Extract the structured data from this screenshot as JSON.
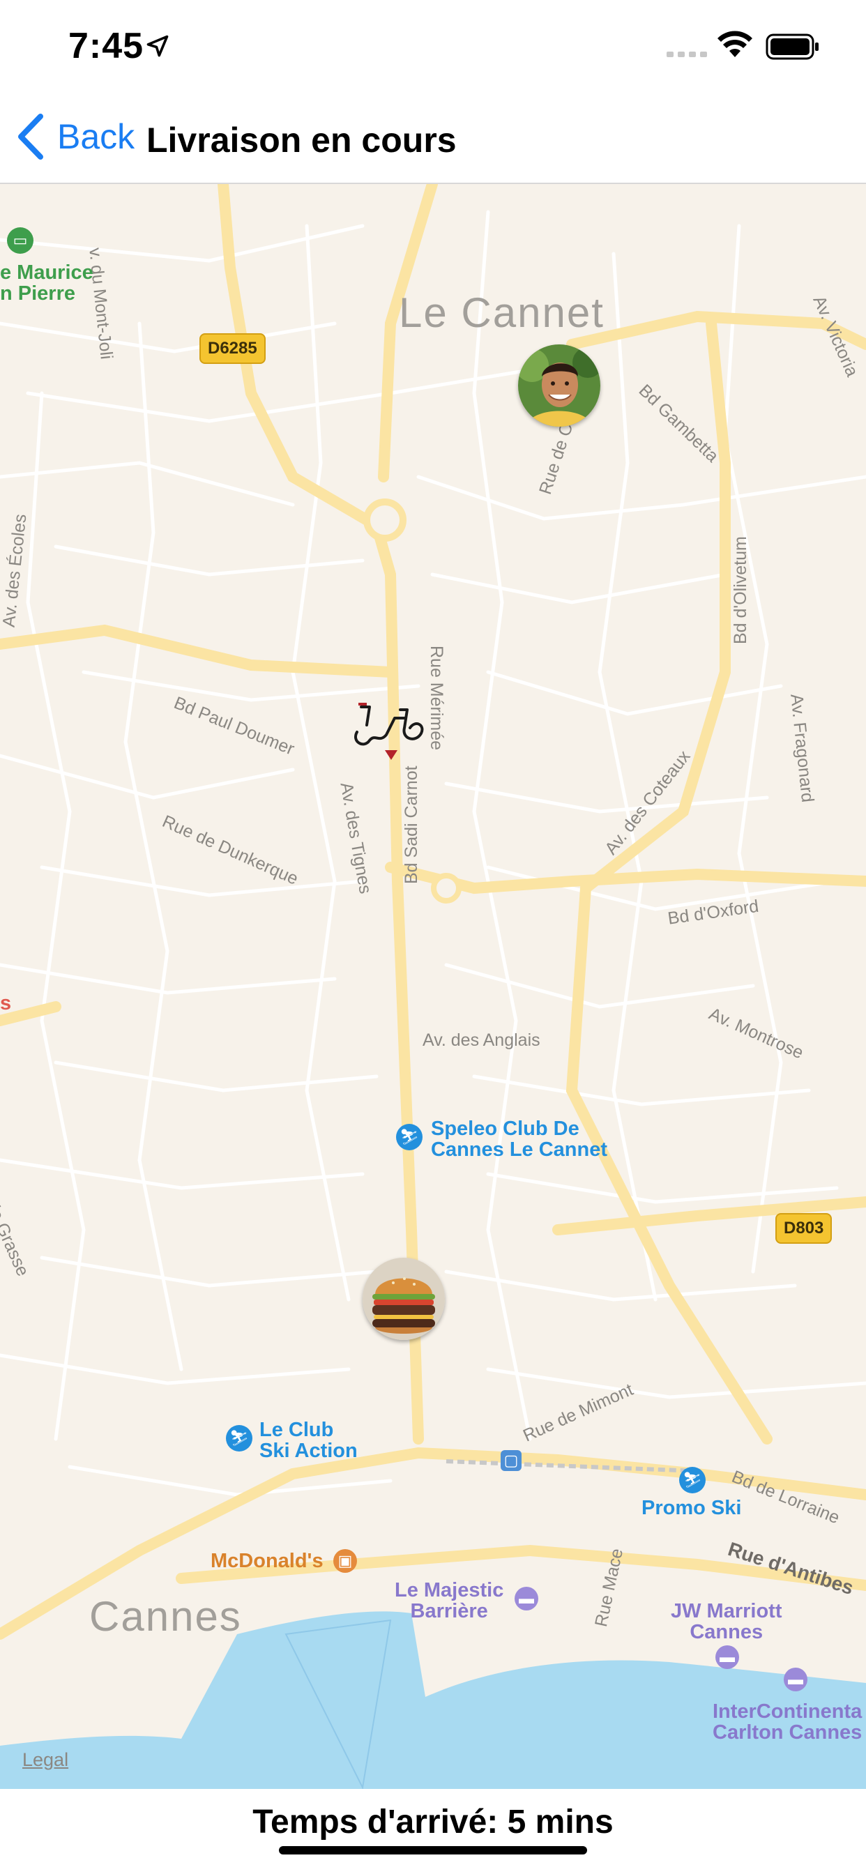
{
  "status_bar": {
    "time": "7:45",
    "icons": [
      "location-arrow-icon",
      "cellular-signal-icon",
      "wifi-icon",
      "battery-icon"
    ]
  },
  "nav": {
    "back_label": "Back",
    "title": "Livraison en cours",
    "accent_color": "#1a7df2"
  },
  "map": {
    "legal": "Legal",
    "city_labels": {
      "le_cannet": "Le Cannet",
      "cannes": "Cannes"
    },
    "road_badges": {
      "d6285": "D6285",
      "d803": "D803"
    },
    "street_labels": {
      "mont_joli": "v. du Mont-Joli",
      "ecoles": "Av. des Écoles",
      "paul_doumer": "Bd Paul Doumer",
      "merimee": "Rue Mérimée",
      "dunkerque": "Rue de Dunkerque",
      "tignes": "Av. des Tignes",
      "sadi_carnot": "Bd Sadi Carnot",
      "gambetta": "Bd Gambetta",
      "rue_de_c": "Rue de C",
      "olivetum": "Bd d'Olivetum",
      "victoria": "Av. Victoria",
      "fragonard": "Av. Fragonard",
      "coteaux": "Av. des Coteaux",
      "oxford": "Bd d'Oxford",
      "montrose": "Av. Montrose",
      "anglais": "Av. des Anglais",
      "grasse": "de Grasse",
      "mimont": "Rue de Mimont",
      "lorraine": "Bd de Lorraine",
      "antibes": "Rue d'Antibes",
      "mace": "Rue Mace"
    },
    "pois": {
      "maurice_line1": "e Maurice",
      "maurice_line2": "n Pierre",
      "speleo_line1": "Speleo Club De",
      "speleo_line2": "Cannes Le Cannet",
      "club_ski_line1": "Le Club",
      "club_ski_line2": "Ski Action",
      "promo_ski": "Promo Ski",
      "mcdonalds": "McDonald's",
      "majestic_line1": "Le Majestic",
      "majestic_line2": "Barrière",
      "jw_line1": "JW Marriott",
      "jw_line2": "Cannes",
      "interconti_line1": "InterContinenta",
      "interconti_line2": "Carlton Cannes",
      "left_edge": "s"
    },
    "markers": [
      "customer-avatar",
      "delivery-rider-icon",
      "restaurant-burger-avatar"
    ]
  },
  "footer": {
    "eta": "Temps d'arrivé: 5 mins"
  }
}
